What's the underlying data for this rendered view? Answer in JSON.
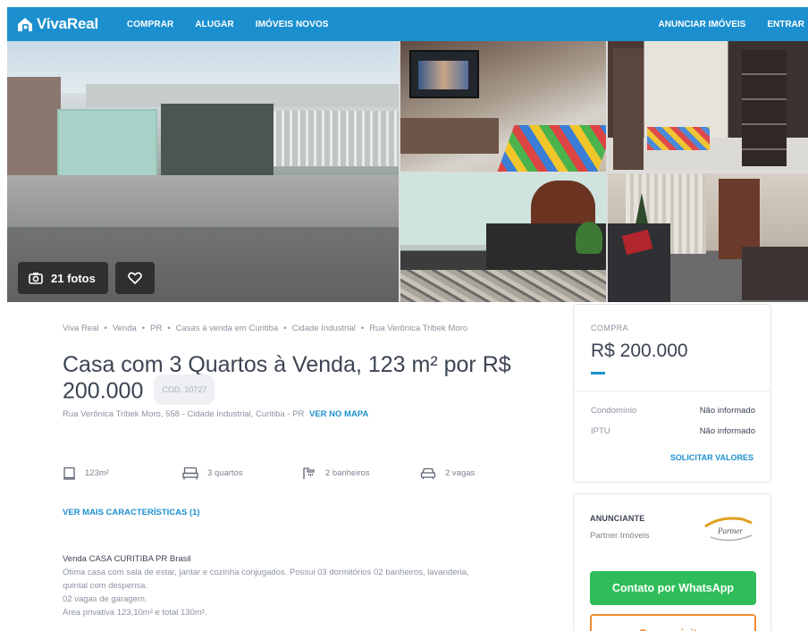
{
  "header": {
    "logo_text": "VivaReal",
    "nav": [
      "COMPRAR",
      "ALUGAR",
      "IMÓVEIS NOVOS"
    ],
    "nav_right": [
      "ANUNCIAR IMÓVEIS",
      "ENTRAR"
    ],
    "color": "#1c90cf"
  },
  "gallery": {
    "photos_label": "21 fotos"
  },
  "listing": {
    "breadcrumb": [
      "Viva Real",
      "Venda",
      "PR",
      "Casas à venda em Curitiba",
      "Cidade Industrial",
      "Rua Verônica Tribek Moro"
    ],
    "title": "Casa com 3 Quartos à Venda, 123 m² por R$ 200.000",
    "code": "COD. 10727",
    "address": "Rua Verônica Tribek Moro, 558 - Cidade Industrial, Curitiba - PR",
    "map_link": "VER NO MAPA",
    "features": {
      "area": "123m²",
      "bedrooms": "3 quartos",
      "bathrooms": "2 banheiros",
      "parking": "2 vagas"
    },
    "more_features": "VER MAIS CARACTERÍSTICAS (1)",
    "description": {
      "heading": "Venda CASA CURITIBA PR Brasil",
      "lines": [
        "Otima casa com sala de estar, jantar e cozinha conjugados. Possui 03 dormitórios 02 banheiros, lavanderia,",
        "quintal com despensa.",
        "02 vagas de garagem.",
        "Área privativa 123,10m² e total 130m²."
      ]
    }
  },
  "price_card": {
    "label": "COMPRA",
    "price": "R$ 200.000",
    "fees": [
      {
        "label": "Condomínio",
        "value": "Não informado"
      },
      {
        "label": "IPTU",
        "value": "Não informado"
      }
    ],
    "request_link": "SOLICITAR VALORES"
  },
  "advertiser": {
    "label": "ANUNCIANTE",
    "name": "Partner Imóveis",
    "logo_text": "Partner",
    "whatsapp_button": "Contato por WhatsApp",
    "visit_button": "Quero visitar",
    "whatsapp_color": "#2ebd59",
    "visit_color": "#f28b30"
  }
}
